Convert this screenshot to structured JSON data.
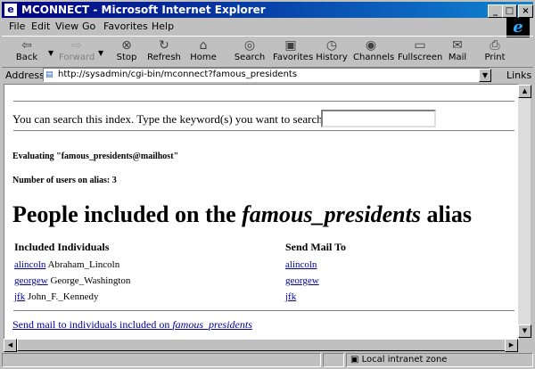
{
  "window": {
    "title": "MCONNECT - Microsoft Internet Explorer"
  },
  "menu": [
    "File",
    "Edit",
    "View",
    "Go",
    "Favorites",
    "Help"
  ],
  "toolbar": [
    {
      "label": "Back",
      "icon": "back-arrow-icon",
      "enabled": true
    },
    {
      "label": "Forward",
      "icon": "forward-arrow-icon",
      "enabled": false
    },
    {
      "label": "Stop",
      "icon": "stop-icon",
      "enabled": true
    },
    {
      "label": "Refresh",
      "icon": "refresh-icon",
      "enabled": true
    },
    {
      "label": "Home",
      "icon": "home-icon",
      "enabled": true
    },
    {
      "label": "Search",
      "icon": "search-icon",
      "enabled": true
    },
    {
      "label": "Favorites",
      "icon": "favorites-icon",
      "enabled": true
    },
    {
      "label": "History",
      "icon": "history-icon",
      "enabled": true
    },
    {
      "label": "Channels",
      "icon": "channels-icon",
      "enabled": true
    },
    {
      "label": "Fullscreen",
      "icon": "fullscreen-icon",
      "enabled": true
    },
    {
      "label": "Mail",
      "icon": "mail-icon",
      "enabled": true
    },
    {
      "label": "Print",
      "icon": "print-icon",
      "enabled": true
    }
  ],
  "address": {
    "label": "Address",
    "url": "http://sysadmin/cgi-bin/mconnect?famous_presidents"
  },
  "links_label": "Links",
  "page": {
    "search_prompt": "You can search this index. Type the keyword(s) you want to search for:",
    "search_value": "",
    "evaluating": "Evaluating \"famous_presidents@mailhost\"",
    "user_count": "Number of users on alias: 3",
    "heading_pre": "People included on the ",
    "heading_alias": "famous_presidents",
    "heading_post": " alias",
    "col_individuals": "Included Individuals",
    "col_sendmail": "Send Mail To",
    "people": [
      {
        "login": "alincoln",
        "name": "Abraham_Lincoln"
      },
      {
        "login": "georgew",
        "name": "George_Washington"
      },
      {
        "login": "jfk",
        "name": "John_F._Kennedy"
      }
    ],
    "send_all_pre": "Send mail to individuals included on ",
    "send_all_alias": "famous_presidents"
  },
  "status": {
    "zone": "Local intranet zone"
  },
  "colors": {
    "titlebar": "#000080",
    "link": "#000099",
    "chrome": "#c0c0c0"
  }
}
